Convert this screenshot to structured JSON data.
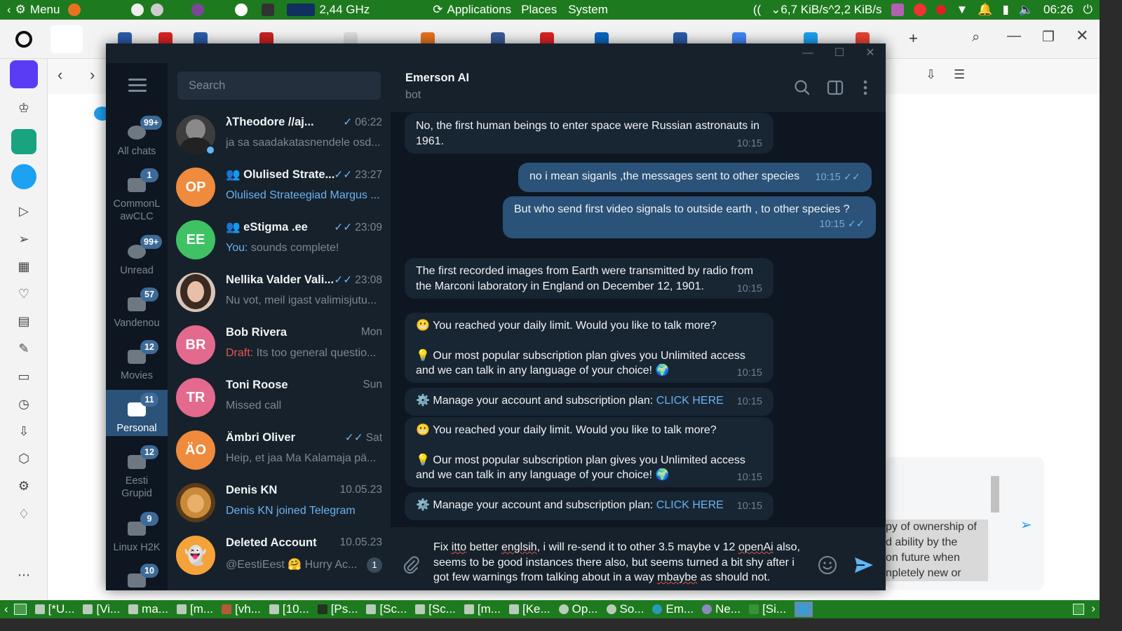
{
  "top_panel": {
    "menu_label": "Menu",
    "cpu_freq": "2,44 GHz",
    "applications": "Applications",
    "places": "Places",
    "system": "System",
    "net_down": "6,7 KiB/s",
    "net_up": "2,2 KiB/s",
    "clock": "06:26"
  },
  "folders": [
    {
      "label": "All chats",
      "badge": "99+"
    },
    {
      "label": "CommonL awCLC",
      "badge": "1"
    },
    {
      "label": "Unread",
      "badge": "99+"
    },
    {
      "label": "Vandenou",
      "badge": "57"
    },
    {
      "label": "Movies",
      "badge": "12"
    },
    {
      "label": "Personal",
      "badge": "11"
    },
    {
      "label": "Eesti Grupid",
      "badge": "12"
    },
    {
      "label": "Linux H2K",
      "badge": "9"
    },
    {
      "label": "",
      "badge": "10"
    }
  ],
  "chat_list": {
    "search_placeholder": "Search",
    "chats": [
      {
        "name": "λTheodore //aj...",
        "time": "06:22",
        "preview": "ja sa saadakatasnendele osd...",
        "initials": "",
        "color": "#4a4a4a"
      },
      {
        "name": "Olulised Strate...",
        "time": "23:27",
        "preview": "Olulised Strateegiad Margus ...",
        "initials": "OP",
        "color": "#f08a3c"
      },
      {
        "name": "eStigma .ee",
        "time": "23:09",
        "preview_prefix": "You:",
        "preview": "sounds complete!",
        "initials": "EE",
        "color": "#3fc264"
      },
      {
        "name": "Nellika Valder Vali...",
        "time": "23:08",
        "preview": "Nu vot, meil igast valimisjutu...",
        "initials": "",
        "color": "#6b4a3e"
      },
      {
        "name": "Bob Rivera",
        "time": "Mon",
        "preview_prefix": "Draft:",
        "preview": "Its too general questio...",
        "initials": "BR",
        "color": "#e36a8e"
      },
      {
        "name": "Toni Roose",
        "time": "Sun",
        "preview": "Missed call",
        "initials": "TR",
        "color": "#e36a8e"
      },
      {
        "name": "Ämbri Oliver",
        "time": "Sat",
        "preview": "Heip, et jaa Ma Kalamaja pä...",
        "initials": "ÄO",
        "color": "#f08a3c"
      },
      {
        "name": "Denis KN",
        "time": "10.05.23",
        "preview": "Denis KN joined Telegram",
        "initials": "",
        "color": "#9a6a2c"
      },
      {
        "name": "Deleted Account",
        "time": "10.05.23",
        "preview": "@EestiEest 🤗 Hurry Ac...",
        "initials": "👻",
        "color": "#f5a23a",
        "unread": "1"
      }
    ]
  },
  "chat": {
    "title": "Emerson AI",
    "subtitle": "bot",
    "messages": [
      {
        "dir": "in",
        "text": "No, the first human beings to enter space were Russian astronauts in 1961.",
        "time": "10:15"
      },
      {
        "dir": "out",
        "text": "no i mean siganls ,the messages sent to other species",
        "time": "10:15"
      },
      {
        "dir": "out",
        "text": "But who send first video signals to  outside earth , to other species ?",
        "time": "10:15"
      },
      {
        "dir": "in",
        "text": "The first recorded images from Earth were transmitted by radio from the Marconi laboratory in England on December 12, 1901.",
        "time": "10:15"
      },
      {
        "dir": "in",
        "line1": "😬 You reached your daily limit. Would you like to talk more?",
        "line2": "💡 Our most popular subscription plan gives you Unlimited access and we can talk in any language of your choice! 🌍",
        "time": "10:15"
      },
      {
        "dir": "in",
        "text": "⚙️ Manage your account and subscription plan:",
        "link": "CLICK HERE",
        "time": "10:15"
      },
      {
        "dir": "in",
        "line1": "😬 You reached your daily limit. Would you like to talk more?",
        "line2": "💡 Our most popular subscription plan gives you Unlimited access and we can talk in any language of your choice! 🌍",
        "time": "10:15"
      },
      {
        "dir": "in",
        "text": "⚙️ Manage your account and subscription plan:",
        "link": "CLICK HERE",
        "time": "10:15"
      }
    ],
    "composer_text": {
      "p1": "Fix ",
      "w1": "itto",
      "p2": " better ",
      "w2": "englsih",
      "p3": ", i will re-send it to other 3.5 maybe v 12 ",
      "w3": "openAi",
      "p4": " also, seems to be good instances there also, but seems turned a bit shy after i got few warnings from talking about in a way ",
      "w4": "mbaybe",
      "p5": " as should not."
    }
  },
  "right_panel": {
    "snippet_lines": [
      "py of ownership of",
      "d ability by the",
      "on future when",
      "npletely new or"
    ]
  },
  "taskbar": {
    "items": [
      "[*U...",
      "[Vi...",
      "ma...",
      "[m...",
      "[vh...",
      "[10...",
      "[Ps...",
      "[Sc...",
      "[Sc...",
      "[m...",
      "[Ke...",
      "Op...",
      "So...",
      "Em...",
      "Ne...",
      "[Si..."
    ]
  },
  "colors": {
    "panel_green": "#1e7a1e",
    "tg_bg": "#0e1621",
    "tg_panel": "#17212b",
    "bubble_in": "#182533",
    "bubble_out": "#2b5278",
    "accent": "#6ab2f2"
  }
}
